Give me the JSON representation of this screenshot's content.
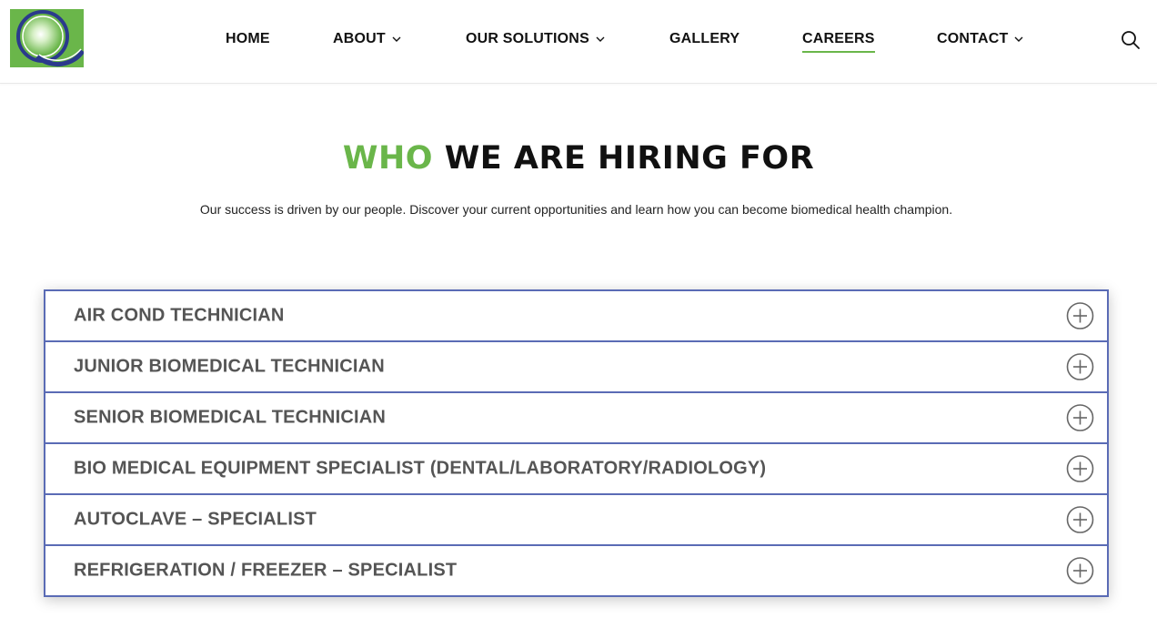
{
  "header": {
    "logo_alt": "Q",
    "nav": [
      {
        "label": "HOME",
        "has_dropdown": false,
        "active": false
      },
      {
        "label": "ABOUT",
        "has_dropdown": true,
        "active": false
      },
      {
        "label": "OUR SOLUTIONS",
        "has_dropdown": true,
        "active": false
      },
      {
        "label": "GALLERY",
        "has_dropdown": false,
        "active": false
      },
      {
        "label": "CAREERS",
        "has_dropdown": false,
        "active": true
      },
      {
        "label": "CONTACT",
        "has_dropdown": true,
        "active": false
      }
    ],
    "search_icon": "search-icon"
  },
  "hero": {
    "title_accent": "WHO",
    "title_rest": "WE ARE HIRING FOR",
    "subtitle": "Our success is driven by our people. Discover your current opportunities and learn how you can become biomedical health champion."
  },
  "jobs": [
    {
      "title": "AIR COND TECHNICIAN"
    },
    {
      "title": "JUNIOR BIOMEDICAL TECHNICIAN"
    },
    {
      "title": "SENIOR BIOMEDICAL TECHNICIAN"
    },
    {
      "title": "BIO MEDICAL EQUIPMENT SPECIALIST (DENTAL/LABORATORY/RADIOLOGY)"
    },
    {
      "title": "AUTOCLAVE – SPECIALIST"
    },
    {
      "title": "REFRIGERATION / FREEZER – SPECIALIST"
    }
  ],
  "colors": {
    "accent_green": "#6ab64a",
    "accordion_border": "#5a6bb5",
    "logo_blue": "#2b3a8c"
  }
}
